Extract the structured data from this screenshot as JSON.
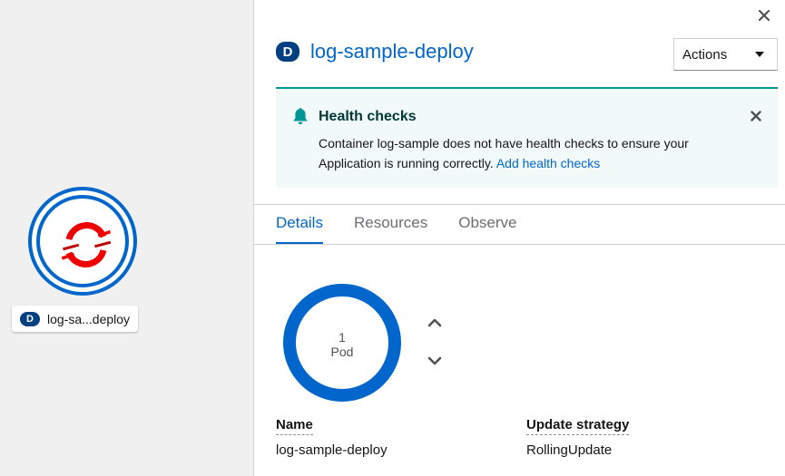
{
  "topology": {
    "node": {
      "badge": "D",
      "label": "log-sa...deploy",
      "icon": "openshift-icon"
    }
  },
  "panel": {
    "close_icon": "close-icon",
    "badge": "D",
    "title": "log-sample-deploy",
    "actions_label": "Actions",
    "alert": {
      "icon": "bell-icon",
      "title": "Health checks",
      "message": "Container log-sample does not have health checks to ensure your Application is running correctly.",
      "link": "Add health checks"
    },
    "tabs": [
      {
        "label": "Details",
        "active": true
      },
      {
        "label": "Resources",
        "active": false
      },
      {
        "label": "Observe",
        "active": false
      }
    ],
    "pods": {
      "count": "1",
      "unit": "Pod"
    },
    "details": {
      "name_label": "Name",
      "name_value": "log-sample-deploy",
      "strategy_label": "Update strategy",
      "strategy_value": "RollingUpdate"
    }
  },
  "colors": {
    "accent": "#0066cc",
    "badge": "#004080",
    "alert_border": "#009596",
    "alert_bg": "#f2f9f9",
    "logo_red": "#ee0000"
  }
}
